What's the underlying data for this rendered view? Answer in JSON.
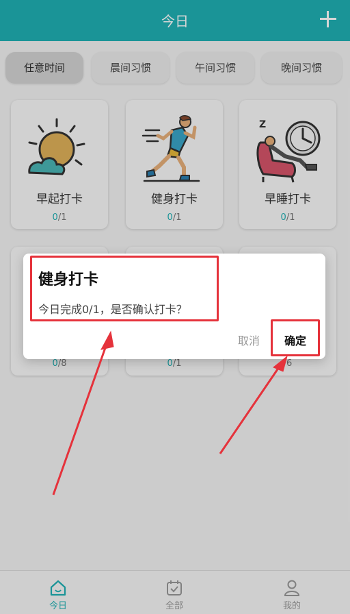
{
  "header": {
    "title": "今日"
  },
  "tabs": [
    {
      "label": "任意时间",
      "active": true
    },
    {
      "label": "晨间习惯",
      "active": false
    },
    {
      "label": "午间习惯",
      "active": false
    },
    {
      "label": "晚间习惯",
      "active": false
    }
  ],
  "cards": [
    {
      "name": "早起打卡",
      "done": "0",
      "total": "/1",
      "icon": "sunrise-icon"
    },
    {
      "name": "健身打卡",
      "done": "0",
      "total": "/1",
      "icon": "running-person-icon"
    },
    {
      "name": "早睡打卡",
      "done": "0",
      "total": "/1",
      "icon": "sleeping-clock-icon"
    }
  ],
  "cards_row2": [
    {
      "done": "0",
      "total": "/8"
    },
    {
      "done": "0",
      "total": "/1"
    },
    {
      "done": "",
      "total": "/6"
    }
  ],
  "dialog": {
    "title": "健身打卡",
    "message": "今日完成0/1，是否确认打卡？",
    "cancel": "取消",
    "confirm": "确定"
  },
  "bottom_nav": [
    {
      "label": "今日",
      "icon": "home-icon",
      "active": true
    },
    {
      "label": "全部",
      "icon": "calendar-icon",
      "active": false
    },
    {
      "label": "我的",
      "icon": "user-icon",
      "active": false
    }
  ],
  "colors": {
    "accent": "#1fb1b4",
    "highlight": "#e5323b"
  }
}
